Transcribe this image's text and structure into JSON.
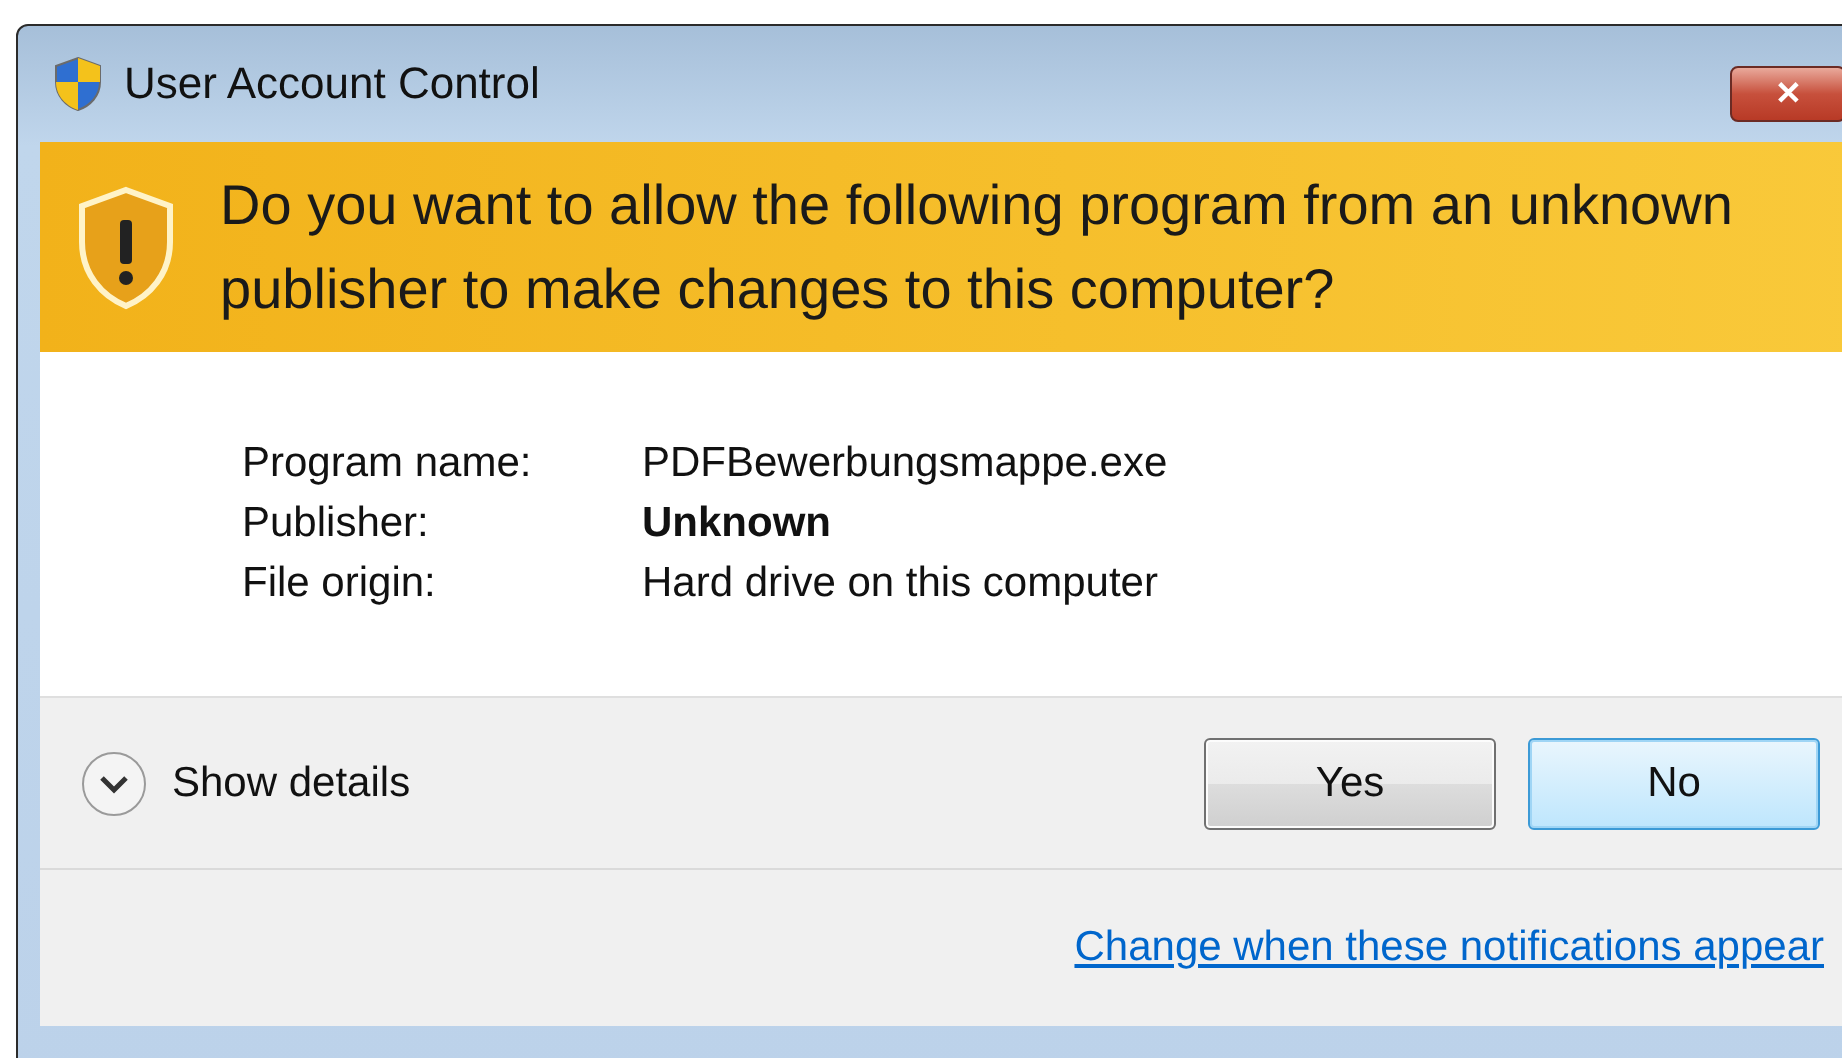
{
  "window": {
    "title": "User Account Control",
    "close": "✕"
  },
  "banner": {
    "question": "Do you want to allow the following program from an unknown publisher to make changes to this computer?"
  },
  "details": [
    {
      "label": "Program name:",
      "value": "PDFBewerbungsmappe.exe",
      "bold": false
    },
    {
      "label": "Publisher:",
      "value": "Unknown",
      "bold": true
    },
    {
      "label": "File origin:",
      "value": "Hard drive on this computer",
      "bold": false
    }
  ],
  "show_details": {
    "label": "Show details",
    "expanded": false
  },
  "buttons": [
    {
      "label": "Yes",
      "selected": false
    },
    {
      "label": "No",
      "selected": true
    }
  ],
  "link": "Change when these notifications appear"
}
